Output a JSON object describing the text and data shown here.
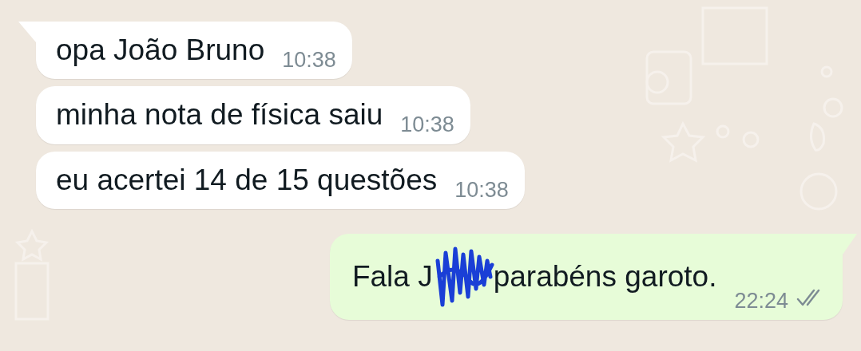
{
  "messages": [
    {
      "kind": "incoming",
      "tail": true,
      "text": "opa João Bruno",
      "time": "10:38"
    },
    {
      "kind": "incoming",
      "tail": false,
      "text": "minha nota de física saiu",
      "time": "10:38"
    },
    {
      "kind": "incoming",
      "tail": false,
      "text": "eu acertei 14 de 15 questões",
      "time": "10:38"
    },
    {
      "kind": "outgoing",
      "tail": true,
      "text": "Fala J",
      "redacted": true,
      "text_after": "parabéns garoto.",
      "time": "22:24",
      "delivered": true
    }
  ]
}
